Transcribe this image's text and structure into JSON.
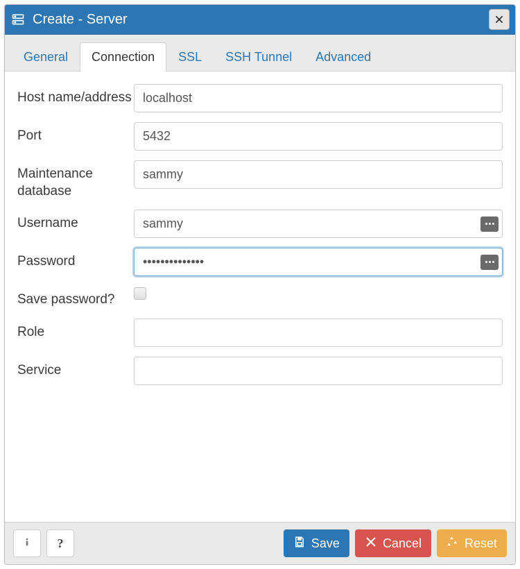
{
  "dialog": {
    "title": "Create - Server"
  },
  "tabs": [
    {
      "label": "General",
      "active": false
    },
    {
      "label": "Connection",
      "active": true
    },
    {
      "label": "SSL",
      "active": false
    },
    {
      "label": "SSH Tunnel",
      "active": false
    },
    {
      "label": "Advanced",
      "active": false
    }
  ],
  "form": {
    "host": {
      "label": "Host name/address",
      "value": "localhost"
    },
    "port": {
      "label": "Port",
      "value": "5432"
    },
    "maintenance_db": {
      "label": "Maintenance database",
      "value": "sammy"
    },
    "username": {
      "label": "Username",
      "value": "sammy"
    },
    "password": {
      "label": "Password",
      "value": "••••••••••••••"
    },
    "save_password": {
      "label": "Save password?",
      "checked": false
    },
    "role": {
      "label": "Role",
      "value": ""
    },
    "service": {
      "label": "Service",
      "value": ""
    }
  },
  "footer": {
    "info_icon": "info-icon",
    "help_icon": "help-icon",
    "save": "Save",
    "cancel": "Cancel",
    "reset": "Reset"
  },
  "colors": {
    "primary": "#2c76b4",
    "danger": "#d9534f",
    "warning": "#f0ad4e"
  }
}
